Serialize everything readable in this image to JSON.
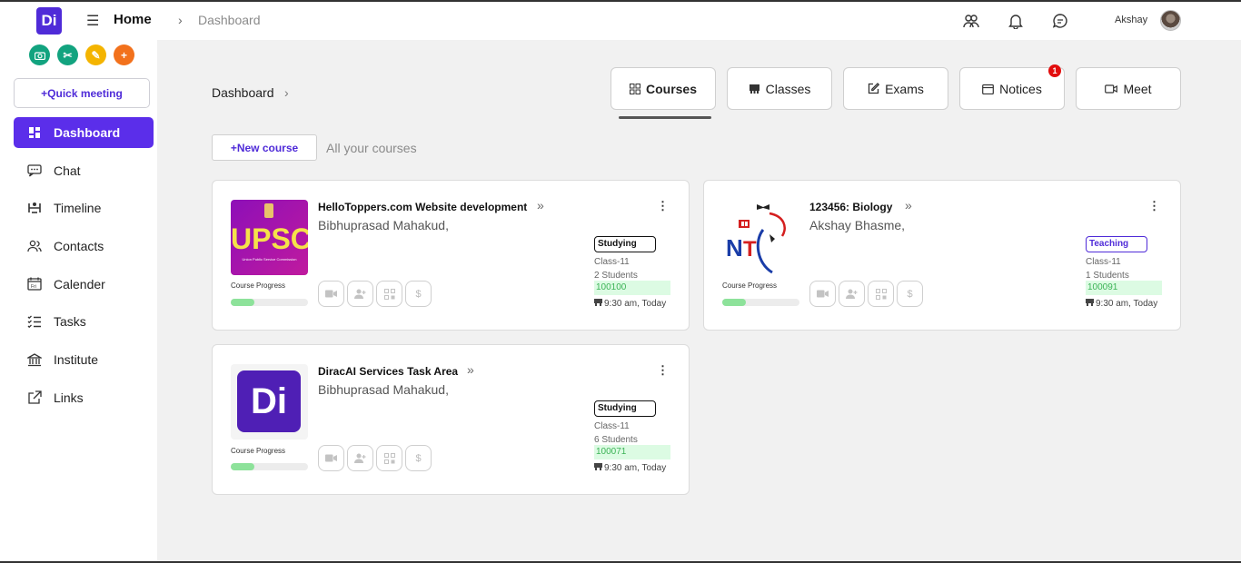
{
  "topbar": {
    "logo_text": "Di",
    "home_label": "Home",
    "breadcrumb_sep": "›",
    "breadcrumb": "Dashboard",
    "user_name": "Akshay",
    "icons": [
      "contacts-icon",
      "bell-icon",
      "chat-icon"
    ]
  },
  "sidebar": {
    "quick_icons": [
      {
        "name": "camera-icon",
        "color": "#12a37f"
      },
      {
        "name": "tools-icon",
        "color": "#12a37f"
      },
      {
        "name": "pencil-icon",
        "color": "#f4b400"
      },
      {
        "name": "plus-icon",
        "color": "#f2711c"
      }
    ],
    "quick_meeting": "+Quick meeting",
    "items": [
      {
        "label": "Dashboard",
        "icon": "dashboard-icon",
        "active": true
      },
      {
        "label": "Chat",
        "icon": "chat-icon"
      },
      {
        "label": "Timeline",
        "icon": "timeline-icon"
      },
      {
        "label": "Contacts",
        "icon": "contacts-icon"
      },
      {
        "label": "Calender",
        "icon": "calendar-icon"
      },
      {
        "label": "Tasks",
        "icon": "tasks-icon"
      },
      {
        "label": "Institute",
        "icon": "institute-icon"
      },
      {
        "label": "Links",
        "icon": "external-link-icon"
      }
    ]
  },
  "main": {
    "title": "Dashboard",
    "title_chevron": "›",
    "tabs": [
      {
        "label": "Courses",
        "icon": "grid-icon",
        "active": true
      },
      {
        "label": "Classes",
        "icon": "classes-icon"
      },
      {
        "label": "Exams",
        "icon": "edit-icon"
      },
      {
        "label": "Notices",
        "icon": "notice-icon",
        "badge": "1"
      },
      {
        "label": "Meet",
        "icon": "video-icon"
      }
    ],
    "new_course": "+New course",
    "all_courses": "All your courses",
    "course_progress_label": "Course Progress",
    "more_arrow": "»",
    "kebab": "⋮",
    "courses": [
      {
        "title": "HelloToppers.com Website development",
        "teacher": "Bibhuprasad Mahakud,",
        "status": "Studying",
        "class": "Class-11",
        "students": "2 Students",
        "code": "100100",
        "time": "9:30 am, Today",
        "progress": 0.3,
        "thumb": "upsc",
        "thumb_text": "UPSC",
        "thumb_sub": "Union Public Service Commission"
      },
      {
        "title": "123456: Biology",
        "teacher": "Akshay Bhasme,",
        "status": "Teaching",
        "class": "Class-11",
        "students": "1 Students",
        "code": "100091",
        "time": "9:30 am, Today",
        "progress": 0.3,
        "thumb": "nti",
        "thumb_text": "NTI"
      },
      {
        "title": "DiracAI Services Task Area",
        "teacher": "Bibhuprasad Mahakud,",
        "status": "Studying",
        "class": "Class-11",
        "students": "6 Students",
        "code": "100071",
        "time": "9:30 am, Today",
        "progress": 0.3,
        "thumb": "di",
        "thumb_text": "Di"
      }
    ]
  }
}
